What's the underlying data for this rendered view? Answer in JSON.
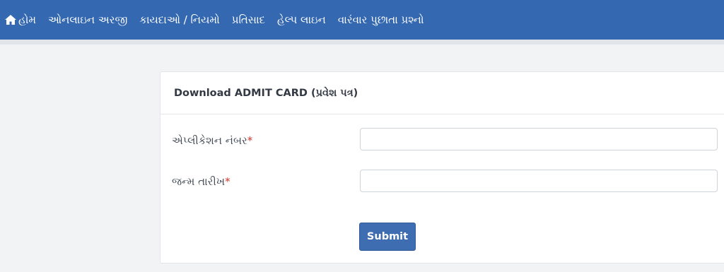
{
  "nav": {
    "items": [
      {
        "label": "હોમ",
        "icon": "home-icon"
      },
      {
        "label": "ઓનલાઇન અરજી"
      },
      {
        "label": "કાયદાઓ / નિયમો"
      },
      {
        "label": "પ્રતિસાદ"
      },
      {
        "label": "હેલ્પ લાઇન"
      },
      {
        "label": "વારંવાર પુછાતા પ્રશ્નો"
      }
    ],
    "background": "#3468b0"
  },
  "card": {
    "title": "Download ADMIT CARD (પ્રવેશ પત્ર)",
    "fields": [
      {
        "label": "એપ્લીકેશન નંબર",
        "required_mark": "*",
        "value": ""
      },
      {
        "label": "જન્મ તારીખ",
        "required_mark": "*",
        "value": ""
      }
    ],
    "submit_label": "Submit"
  }
}
